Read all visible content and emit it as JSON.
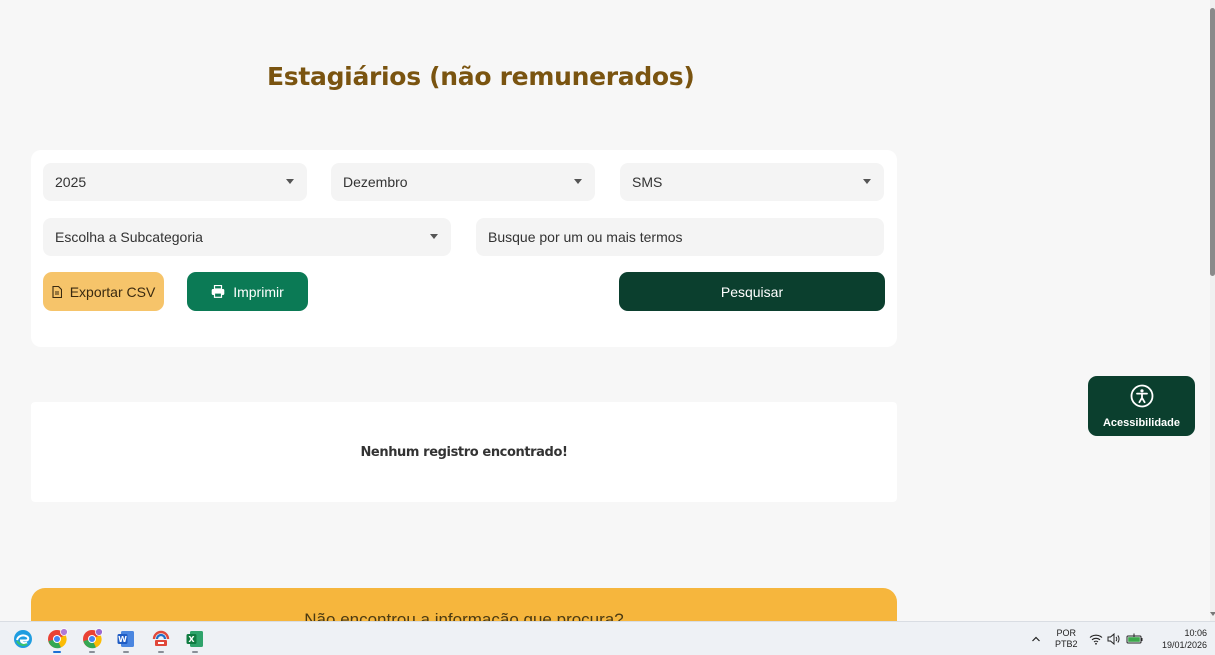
{
  "page": {
    "title": "Estagiários (não remunerados)"
  },
  "filters": {
    "year": "2025",
    "month": "Dezembro",
    "agency": "SMS",
    "subcategory": "Escolha a Subcategoria",
    "search_placeholder": "Busque por um ou mais termos"
  },
  "actions": {
    "export_csv": "Exportar CSV",
    "print": "Imprimir",
    "search": "Pesquisar"
  },
  "results": {
    "empty_message": "Nenhum registro encontrado!"
  },
  "help": {
    "text": "Não encontrou a informação que procura?"
  },
  "accessibility": {
    "label": "Acessibilidade"
  },
  "taskbar": {
    "apps": [
      "edge-icon",
      "chrome-icon",
      "chrome-profile-icon",
      "word-icon",
      "remote-access-icon",
      "excel-icon"
    ],
    "lang_top": "POR",
    "lang_bottom": "PTB2",
    "time": "10:06",
    "date": "19/01/2026"
  },
  "colors": {
    "title": "#7a5410",
    "export_btn": "#f6c46a",
    "print_btn": "#0b7a55",
    "search_btn": "#0b3f2e",
    "banner": "#f6b63d"
  }
}
